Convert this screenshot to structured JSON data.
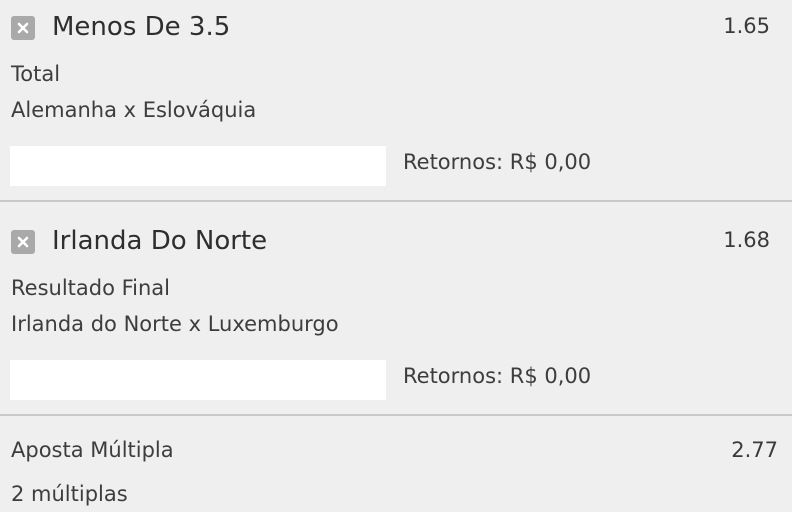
{
  "bets": [
    {
      "selection": "Menos De 3.5",
      "odds": "1.65",
      "market": "Total",
      "event": "Alemanha x Eslováquia",
      "stake_value": "",
      "returns": "Retornos: R$ 0,00"
    },
    {
      "selection": "Irlanda Do Norte",
      "odds": "1.68",
      "market": "Resultado Final",
      "event": "Irlanda do Norte x Luxemburgo",
      "stake_value": "",
      "returns": "Retornos: R$ 0,00"
    }
  ],
  "multiple": {
    "title": "Aposta Múltipla",
    "odds": "2.77",
    "count": "2 múltiplas"
  },
  "icons": {
    "remove": "close-icon"
  },
  "colors": {
    "background": "#efefef",
    "remove_button": "#a9a9a9",
    "divider": "#c9c9c9"
  }
}
